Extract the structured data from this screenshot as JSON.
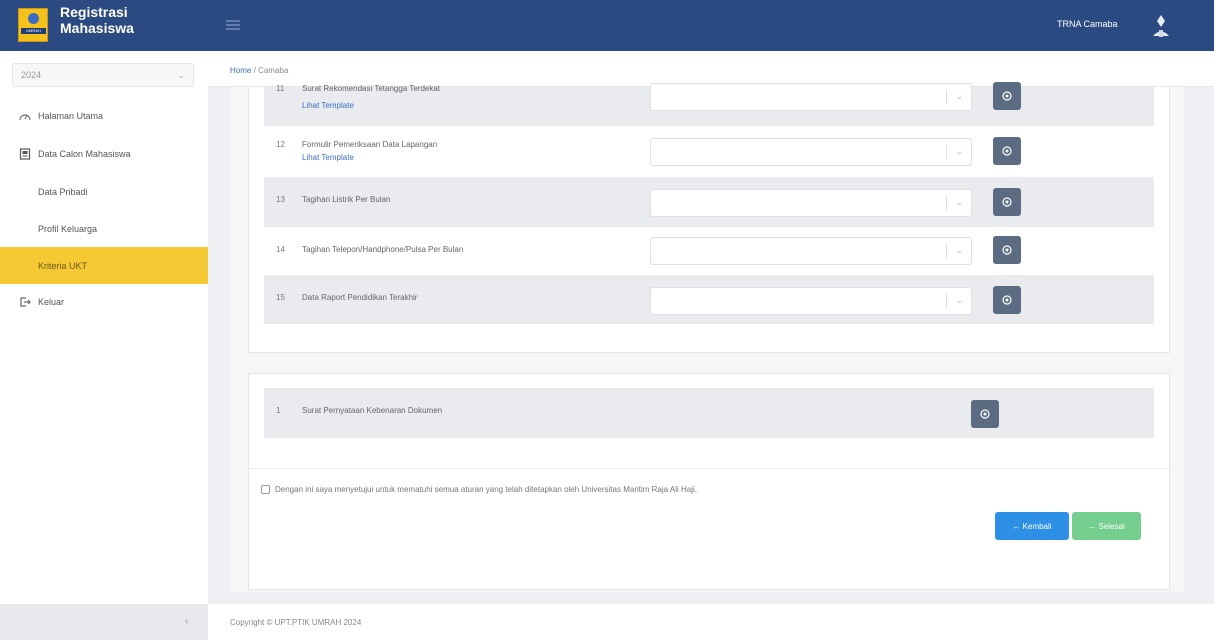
{
  "app": {
    "title_line1": "Registrasi",
    "title_line2": "Mahasiswa",
    "logo_text": "UMRAH",
    "user_name": "TRNA Camaba",
    "brand_color": "#2c4a82",
    "accent_color": "#f4c934"
  },
  "sidebar": {
    "year": "2024",
    "items": [
      {
        "label": "Halaman Utama",
        "icon": "dashboard-icon"
      },
      {
        "label": "Data Calon Mahasiswa",
        "icon": "id-card-icon"
      },
      {
        "label": "Data Pribadi"
      },
      {
        "label": "Profil Keluarga"
      },
      {
        "label": "Kriteria UKT",
        "active": true
      },
      {
        "label": "Keluar",
        "icon": "logout-icon"
      }
    ]
  },
  "breadcrumb": {
    "home": "Home",
    "separator": "/",
    "current": "Camaba"
  },
  "documents": [
    {
      "num": "11",
      "name": "Surat Rekomendasi Tetangga Terdekat",
      "link": "Lihat Template"
    },
    {
      "num": "12",
      "name": "Formulir Pemeriksaan Data Lapangan",
      "link": "Lihat Template"
    },
    {
      "num": "13",
      "name": "Tagihan Listrik Per Bulan"
    },
    {
      "num": "14",
      "name": "Tagihan Telepon/Handphone/Pulsa Per Bulan"
    },
    {
      "num": "15",
      "name": "Data Raport Pendidikan Terakhir"
    }
  ],
  "statement": {
    "num": "1",
    "name": "Surat Pernyataan Kebenaran Dokumen"
  },
  "agreement": "Dengan ini saya menyetujui untuk mematuhi semua aturan yang telah ditetapkan oleh Universitas Maritim Raja Ali Haji.",
  "buttons": {
    "back": "← Kembali",
    "next": "→ Selesai"
  },
  "footer": {
    "copyright": "Copyright © UPT.PTIK UMRAH 2024",
    "collapse": "‹"
  }
}
